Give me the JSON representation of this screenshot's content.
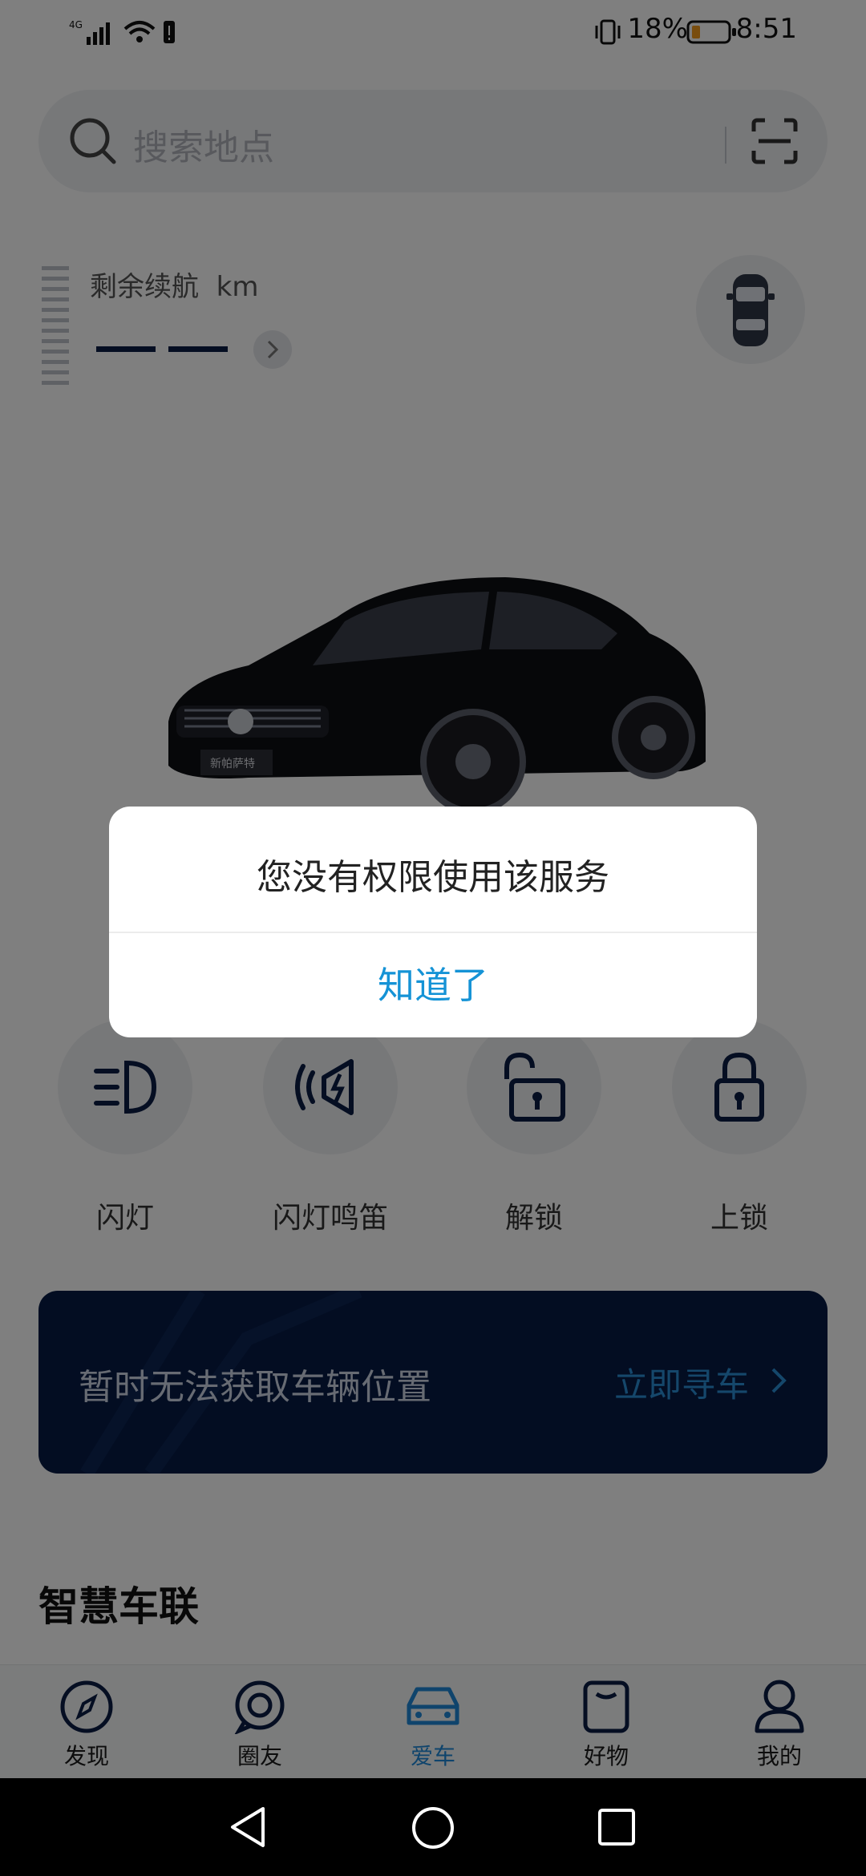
{
  "status_bar": {
    "network": "4G",
    "battery_percent": "18%",
    "time": "8:51"
  },
  "search": {
    "placeholder": "搜索地点"
  },
  "range": {
    "label": "剩余续航",
    "unit": "km",
    "value_placeholder": "— —"
  },
  "controls": [
    {
      "label": "闪灯",
      "icon": "headlight-icon"
    },
    {
      "label": "闪灯鸣笛",
      "icon": "horn-icon"
    },
    {
      "label": "解锁",
      "icon": "unlock-icon"
    },
    {
      "label": "上锁",
      "icon": "lock-icon"
    }
  ],
  "location": {
    "message": "暂时无法获取车辆位置",
    "action": "立即寻车"
  },
  "section_title": "智慧车联",
  "car_badge": "新帕萨特",
  "bottom_nav": [
    {
      "label": "发现",
      "icon": "compass-icon",
      "active": false
    },
    {
      "label": "圈友",
      "icon": "chat-icon",
      "active": false
    },
    {
      "label": "爱车",
      "icon": "car-icon",
      "active": true
    },
    {
      "label": "好物",
      "icon": "bag-icon",
      "active": false
    },
    {
      "label": "我的",
      "icon": "profile-icon",
      "active": false
    }
  ],
  "dialog": {
    "message": "您没有权限使用该服务",
    "button": "知道了"
  },
  "colors": {
    "accent": "#1593d6",
    "banner_bg": "#061a45",
    "icon_dark": "#0b1c44",
    "scrim": "rgba(0,0,0,0.5)"
  }
}
